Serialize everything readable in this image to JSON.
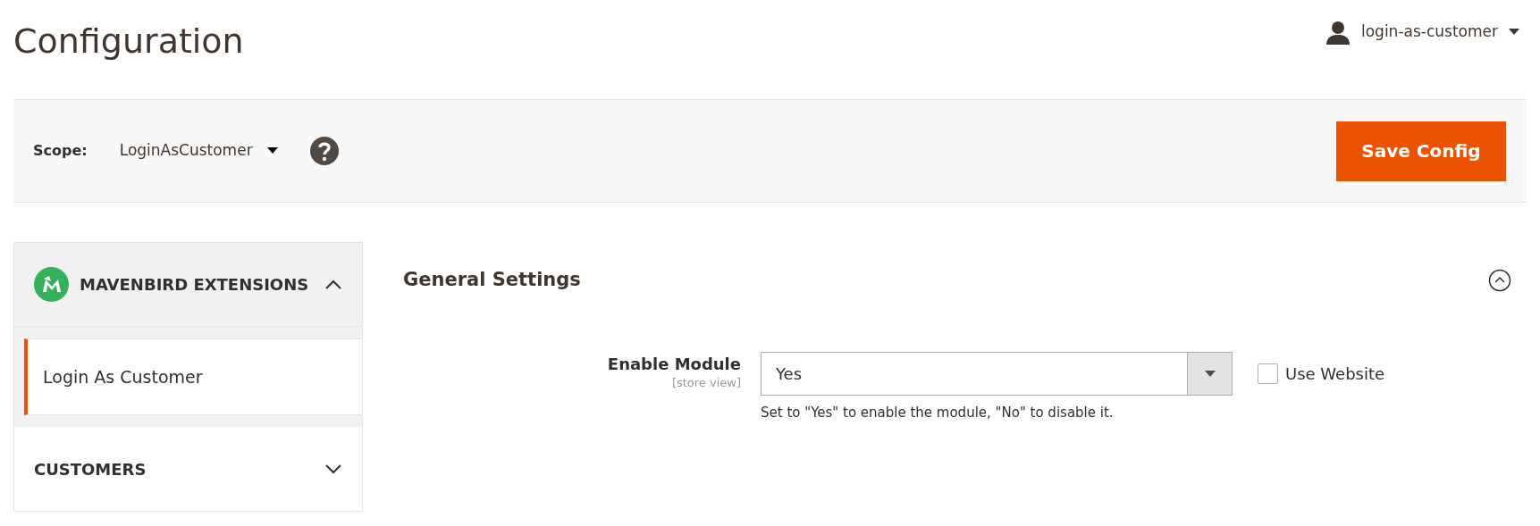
{
  "page_title": "Configuration",
  "user_menu": {
    "label": "login-as-customer"
  },
  "scope": {
    "label": "Scope:",
    "value": "LoginAsCustomer"
  },
  "save_button": "Save Config",
  "sidebar": [
    {
      "title": "MAVENBIRD EXTENSIONS",
      "kind": "brand",
      "expanded": true,
      "items": [
        {
          "label": "Login As Customer",
          "selected": true
        }
      ]
    },
    {
      "title": "CUSTOMERS",
      "kind": "plain",
      "expanded": false
    }
  ],
  "section": {
    "title": "General Settings",
    "expanded": true,
    "fields": [
      {
        "label": "Enable Module",
        "scope": "[store view]",
        "value": "Yes",
        "note": "Set to \"Yes\" to enable the module, \"No\" to disable it.",
        "use_default_label": "Use Website",
        "use_default_checked": false
      }
    ]
  }
}
